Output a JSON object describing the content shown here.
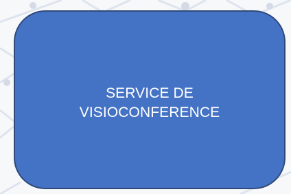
{
  "tile": {
    "label_line1": "SERVICE DE",
    "label_line2": "VISIOCONFERENCE"
  },
  "colors": {
    "tile_fill": "#4472c4",
    "tile_border": "#2f4a78",
    "text": "#ffffff",
    "background": "#f7f8fa",
    "pattern": "#dde4ee"
  }
}
